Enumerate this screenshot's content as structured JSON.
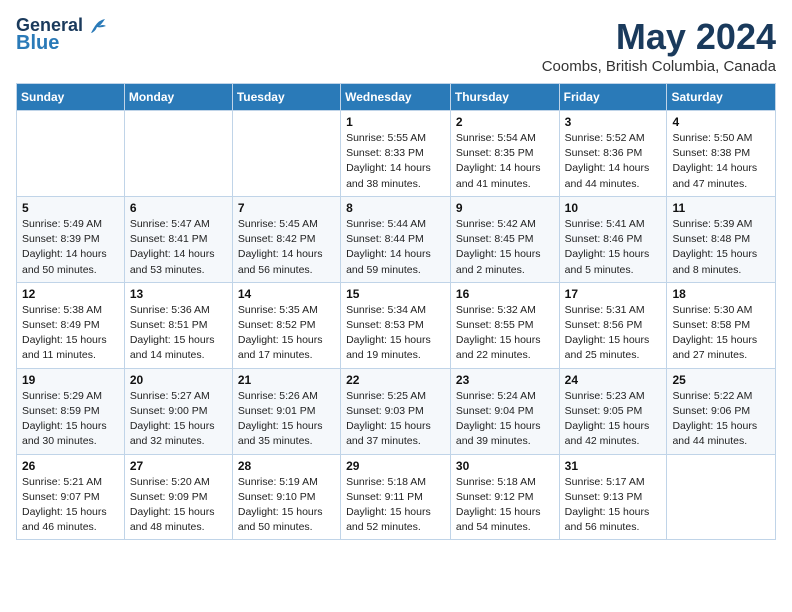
{
  "header": {
    "logo_line1": "General",
    "logo_line2": "Blue",
    "month": "May 2024",
    "location": "Coombs, British Columbia, Canada"
  },
  "weekdays": [
    "Sunday",
    "Monday",
    "Tuesday",
    "Wednesday",
    "Thursday",
    "Friday",
    "Saturday"
  ],
  "weeks": [
    [
      {
        "day": "",
        "info": ""
      },
      {
        "day": "",
        "info": ""
      },
      {
        "day": "",
        "info": ""
      },
      {
        "day": "1",
        "info": "Sunrise: 5:55 AM\nSunset: 8:33 PM\nDaylight: 14 hours\nand 38 minutes."
      },
      {
        "day": "2",
        "info": "Sunrise: 5:54 AM\nSunset: 8:35 PM\nDaylight: 14 hours\nand 41 minutes."
      },
      {
        "day": "3",
        "info": "Sunrise: 5:52 AM\nSunset: 8:36 PM\nDaylight: 14 hours\nand 44 minutes."
      },
      {
        "day": "4",
        "info": "Sunrise: 5:50 AM\nSunset: 8:38 PM\nDaylight: 14 hours\nand 47 minutes."
      }
    ],
    [
      {
        "day": "5",
        "info": "Sunrise: 5:49 AM\nSunset: 8:39 PM\nDaylight: 14 hours\nand 50 minutes."
      },
      {
        "day": "6",
        "info": "Sunrise: 5:47 AM\nSunset: 8:41 PM\nDaylight: 14 hours\nand 53 minutes."
      },
      {
        "day": "7",
        "info": "Sunrise: 5:45 AM\nSunset: 8:42 PM\nDaylight: 14 hours\nand 56 minutes."
      },
      {
        "day": "8",
        "info": "Sunrise: 5:44 AM\nSunset: 8:44 PM\nDaylight: 14 hours\nand 59 minutes."
      },
      {
        "day": "9",
        "info": "Sunrise: 5:42 AM\nSunset: 8:45 PM\nDaylight: 15 hours\nand 2 minutes."
      },
      {
        "day": "10",
        "info": "Sunrise: 5:41 AM\nSunset: 8:46 PM\nDaylight: 15 hours\nand 5 minutes."
      },
      {
        "day": "11",
        "info": "Sunrise: 5:39 AM\nSunset: 8:48 PM\nDaylight: 15 hours\nand 8 minutes."
      }
    ],
    [
      {
        "day": "12",
        "info": "Sunrise: 5:38 AM\nSunset: 8:49 PM\nDaylight: 15 hours\nand 11 minutes."
      },
      {
        "day": "13",
        "info": "Sunrise: 5:36 AM\nSunset: 8:51 PM\nDaylight: 15 hours\nand 14 minutes."
      },
      {
        "day": "14",
        "info": "Sunrise: 5:35 AM\nSunset: 8:52 PM\nDaylight: 15 hours\nand 17 minutes."
      },
      {
        "day": "15",
        "info": "Sunrise: 5:34 AM\nSunset: 8:53 PM\nDaylight: 15 hours\nand 19 minutes."
      },
      {
        "day": "16",
        "info": "Sunrise: 5:32 AM\nSunset: 8:55 PM\nDaylight: 15 hours\nand 22 minutes."
      },
      {
        "day": "17",
        "info": "Sunrise: 5:31 AM\nSunset: 8:56 PM\nDaylight: 15 hours\nand 25 minutes."
      },
      {
        "day": "18",
        "info": "Sunrise: 5:30 AM\nSunset: 8:58 PM\nDaylight: 15 hours\nand 27 minutes."
      }
    ],
    [
      {
        "day": "19",
        "info": "Sunrise: 5:29 AM\nSunset: 8:59 PM\nDaylight: 15 hours\nand 30 minutes."
      },
      {
        "day": "20",
        "info": "Sunrise: 5:27 AM\nSunset: 9:00 PM\nDaylight: 15 hours\nand 32 minutes."
      },
      {
        "day": "21",
        "info": "Sunrise: 5:26 AM\nSunset: 9:01 PM\nDaylight: 15 hours\nand 35 minutes."
      },
      {
        "day": "22",
        "info": "Sunrise: 5:25 AM\nSunset: 9:03 PM\nDaylight: 15 hours\nand 37 minutes."
      },
      {
        "day": "23",
        "info": "Sunrise: 5:24 AM\nSunset: 9:04 PM\nDaylight: 15 hours\nand 39 minutes."
      },
      {
        "day": "24",
        "info": "Sunrise: 5:23 AM\nSunset: 9:05 PM\nDaylight: 15 hours\nand 42 minutes."
      },
      {
        "day": "25",
        "info": "Sunrise: 5:22 AM\nSunset: 9:06 PM\nDaylight: 15 hours\nand 44 minutes."
      }
    ],
    [
      {
        "day": "26",
        "info": "Sunrise: 5:21 AM\nSunset: 9:07 PM\nDaylight: 15 hours\nand 46 minutes."
      },
      {
        "day": "27",
        "info": "Sunrise: 5:20 AM\nSunset: 9:09 PM\nDaylight: 15 hours\nand 48 minutes."
      },
      {
        "day": "28",
        "info": "Sunrise: 5:19 AM\nSunset: 9:10 PM\nDaylight: 15 hours\nand 50 minutes."
      },
      {
        "day": "29",
        "info": "Sunrise: 5:18 AM\nSunset: 9:11 PM\nDaylight: 15 hours\nand 52 minutes."
      },
      {
        "day": "30",
        "info": "Sunrise: 5:18 AM\nSunset: 9:12 PM\nDaylight: 15 hours\nand 54 minutes."
      },
      {
        "day": "31",
        "info": "Sunrise: 5:17 AM\nSunset: 9:13 PM\nDaylight: 15 hours\nand 56 minutes."
      },
      {
        "day": "",
        "info": ""
      }
    ]
  ]
}
